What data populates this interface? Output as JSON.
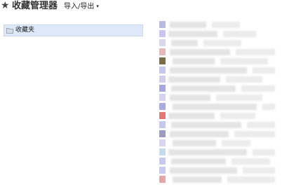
{
  "header": {
    "title": "收藏管理器",
    "menu_label": "导入/导出",
    "caret": "▾",
    "star_icon": "★"
  },
  "tree": {
    "items": [
      {
        "label": "收藏夹",
        "icon": "folder-icon",
        "selected": true
      }
    ]
  },
  "list": {
    "rows": [
      {
        "color": "#b9b9e6"
      },
      {
        "color": "#c7c7f1"
      },
      {
        "color": "#d9d9ee"
      },
      {
        "color": "#e5b9b9"
      },
      {
        "color": "#7b6d48"
      },
      {
        "color": "#c5c9ef"
      },
      {
        "color": "#cfcfe9"
      },
      {
        "color": "#a8a8e0"
      },
      {
        "color": "#d4d4ef"
      },
      {
        "color": "#ababe3"
      },
      {
        "color": "#e57777"
      },
      {
        "color": "#c7c7ef"
      },
      {
        "color": "#9c9cc0"
      },
      {
        "color": "#d6d6f3"
      },
      {
        "color": "#c3dbea"
      },
      {
        "color": "#c9c9ef"
      },
      {
        "color": "#c8c8f0"
      },
      {
        "color": "#e4a7a7"
      }
    ]
  }
}
